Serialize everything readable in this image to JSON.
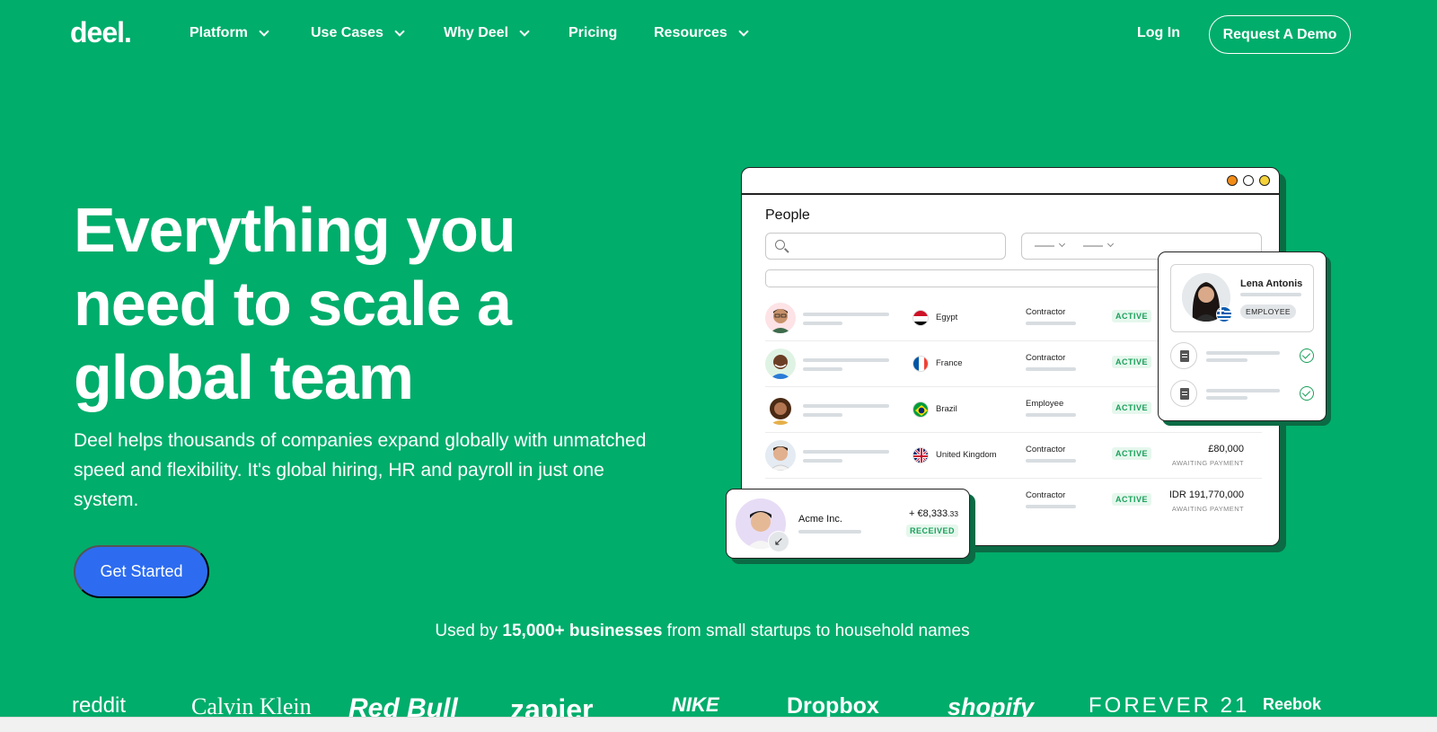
{
  "nav": {
    "logo": "deel.",
    "items": [
      {
        "label": "Platform",
        "dropdown": true
      },
      {
        "label": "Use Cases",
        "dropdown": true
      },
      {
        "label": "Why Deel",
        "dropdown": true
      },
      {
        "label": "Pricing",
        "dropdown": false
      },
      {
        "label": "Resources",
        "dropdown": true
      }
    ],
    "login": "Log In",
    "demo": "Request A Demo"
  },
  "hero": {
    "title": "Everything you need to scale a global team",
    "subtitle": "Deel helps thousands of companies expand globally with unmatched speed and flexibility. It's global hiring, HR and payroll in just one system.",
    "cta": "Get Started"
  },
  "trust": {
    "prefix": "Used by ",
    "bold": "15,000+ businesses",
    "suffix": " from small startups to household names"
  },
  "brands": [
    "reddit",
    "Calvin Klein",
    "Red Bull",
    "zapier",
    "NIKE",
    "Dropbox",
    "shopify",
    "FOREVER 21",
    "Reebok"
  ],
  "app": {
    "title": "People",
    "rows": [
      {
        "country": "Egypt",
        "type": "Contractor",
        "status": "ACTIVE",
        "amount": "",
        "amount_sub": ""
      },
      {
        "country": "France",
        "type": "Contractor",
        "status": "ACTIVE",
        "amount": "",
        "amount_sub": ""
      },
      {
        "country": "Brazil",
        "type": "Employee",
        "status": "ACTIVE",
        "amount": "",
        "amount_sub": ""
      },
      {
        "country": "United Kingdom",
        "type": "Contractor",
        "status": "ACTIVE",
        "amount": "£80,000",
        "amount_sub": "AWAITING PAYMENT"
      },
      {
        "country": "",
        "type": "Contractor",
        "status": "ACTIVE",
        "amount": "IDR 191,770,000",
        "amount_sub": "AWAITING PAYMENT"
      }
    ],
    "window_dot_colors": [
      "#f28c18",
      "#ffffff",
      "#f5d23a"
    ]
  },
  "lena_card": {
    "name": "Lena Antonis",
    "badge": "EMPLOYEE"
  },
  "acme_card": {
    "company": "Acme Inc.",
    "amount": "+ €8,333",
    "amount_decimal": ".33",
    "status": "RECEIVED"
  },
  "colors": {
    "brand_green": "#00ad6b",
    "cta_blue": "#2d6cf0",
    "status_green": "#19a05a"
  }
}
